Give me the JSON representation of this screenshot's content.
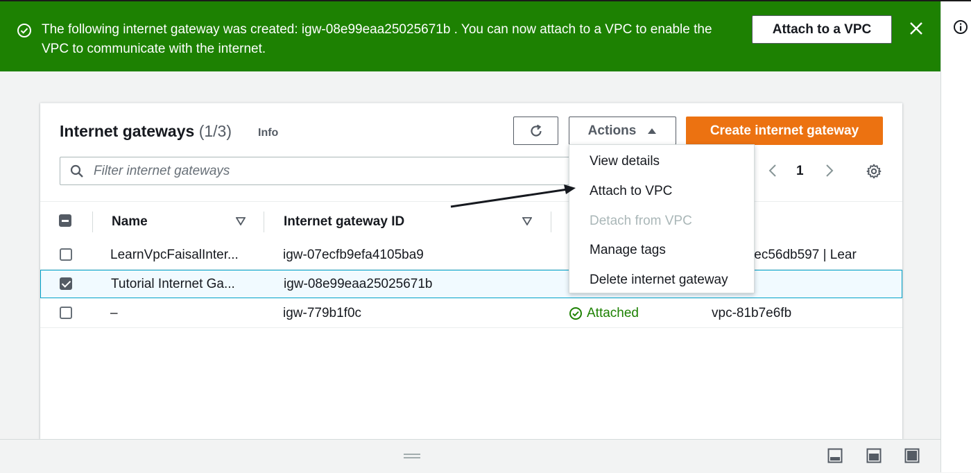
{
  "flash": {
    "message": "The following internet gateway was created: igw-08e99eaa25025671b . You can now attach to a VPC to enable the VPC to communicate with the internet.",
    "attach_button": "Attach to a VPC",
    "success_icon": "check-circle-icon",
    "close_icon": "close-icon",
    "color": "#1d8102"
  },
  "side_panel": {
    "info_icon": "info-icon"
  },
  "table": {
    "title": "Internet gateways",
    "count": "(1/3)",
    "info_link": "Info",
    "refresh_icon": "refresh-icon",
    "actions_label": "Actions",
    "create_button": "Create internet gateway",
    "create_color": "#ec7211",
    "filter_placeholder": "Filter internet gateways",
    "page": "1",
    "columns": [
      "Name",
      "Internet gateway ID"
    ],
    "rows": [
      {
        "name": "LearnVpcFaisalInter...",
        "id": "igw-07ecfb9efa4105ba9",
        "state": "",
        "vpc": "b3c48cec56db597 | Lear",
        "selected": false
      },
      {
        "name": "Tutorial Internet Ga...",
        "id": "igw-08e99eaa25025671b",
        "state": "",
        "vpc": "",
        "selected": true
      },
      {
        "name": "–",
        "id": "igw-779b1f0c",
        "state": "Attached",
        "vpc": "vpc-81b7e6fb",
        "selected": false
      }
    ]
  },
  "actions_menu": {
    "items": [
      {
        "label": "View details",
        "disabled": false
      },
      {
        "label": "Attach to VPC",
        "disabled": false
      },
      {
        "label": "Detach from VPC",
        "disabled": true
      },
      {
        "label": "Manage tags",
        "disabled": false
      },
      {
        "label": "Delete internet gateway",
        "disabled": false
      }
    ]
  },
  "bottom": {
    "icons": [
      "drag-handle-icon",
      "panel-bottom-icon",
      "panel-split-icon",
      "panel-full-icon"
    ]
  }
}
